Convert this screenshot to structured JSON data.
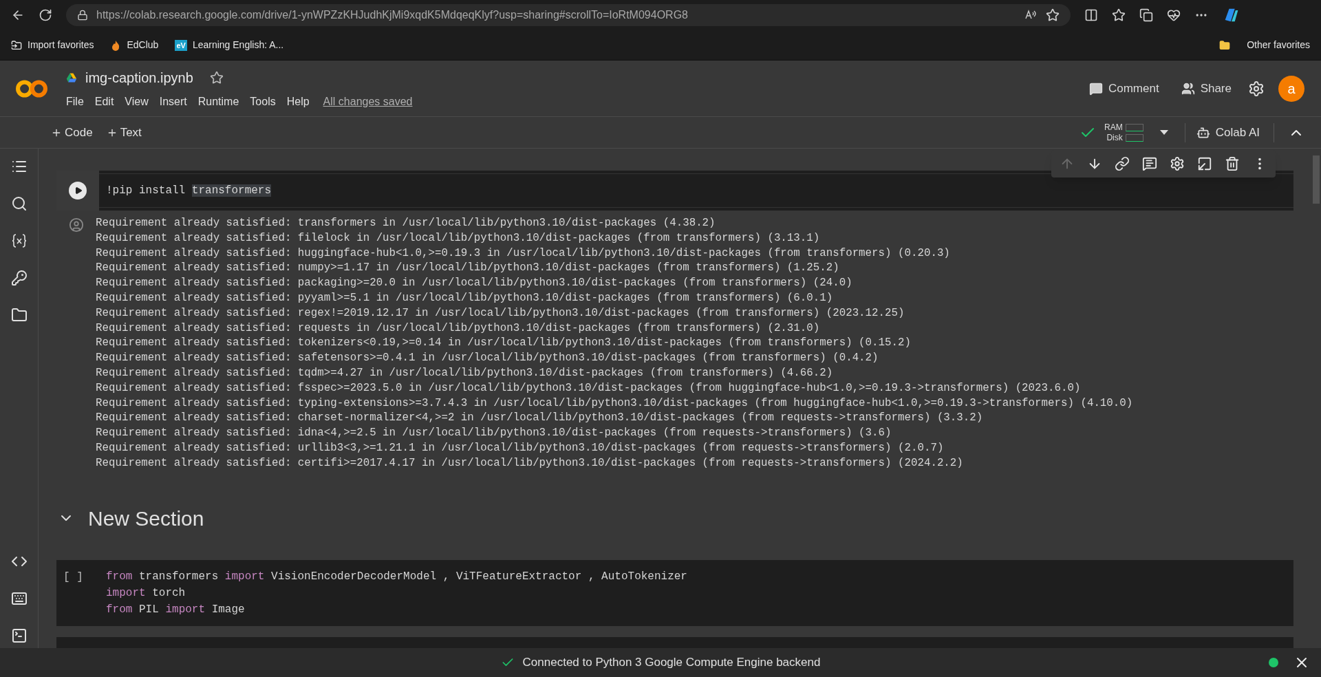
{
  "browser": {
    "url": "https://colab.research.google.com/drive/1-ynWPZzKHJudhKjMi9xqdK5MdqeqKlyf?usp=sharing#scrollTo=IoRtM094ORG8",
    "bookmarks": [
      {
        "kind": "import",
        "label": "Import favorites"
      },
      {
        "kind": "edclub",
        "label": "EdClub"
      },
      {
        "kind": "ev",
        "badge": "eV",
        "label": "Learning English: A..."
      }
    ],
    "other_favorites": "Other favorites"
  },
  "colab": {
    "filename": "img-caption.ipynb",
    "menu": [
      "File",
      "Edit",
      "View",
      "Insert",
      "Runtime",
      "Tools",
      "Help"
    ],
    "save_status": "All changes saved",
    "comment": "Comment",
    "share": "Share",
    "avatar": "a"
  },
  "toolbar": {
    "add": [
      "Code",
      "Text"
    ],
    "ram": "RAM",
    "disk": "Disk",
    "colab_ai": "Colab AI"
  },
  "cell_actions": [
    {
      "kind": "up",
      "disabled": true
    },
    {
      "kind": "down",
      "disabled": false
    },
    {
      "kind": "link",
      "disabled": false
    },
    {
      "kind": "comment",
      "disabled": false
    },
    {
      "kind": "settings",
      "disabled": false
    },
    {
      "kind": "mirror",
      "disabled": false
    },
    {
      "kind": "delete",
      "disabled": false
    },
    {
      "kind": "more",
      "disabled": false
    }
  ],
  "cells": [
    {
      "kind": "code",
      "lines": [
        [
          {
            "kind": "plain",
            "text": "!pip install "
          },
          {
            "kind": "selected",
            "text": "transformers"
          }
        ]
      ],
      "output": [
        "Requirement already satisfied: transformers in /usr/local/lib/python3.10/dist-packages (4.38.2)",
        "Requirement already satisfied: filelock in /usr/local/lib/python3.10/dist-packages (from transformers) (3.13.1)",
        "Requirement already satisfied: huggingface-hub<1.0,>=0.19.3 in /usr/local/lib/python3.10/dist-packages (from transformers) (0.20.3)",
        "Requirement already satisfied: numpy>=1.17 in /usr/local/lib/python3.10/dist-packages (from transformers) (1.25.2)",
        "Requirement already satisfied: packaging>=20.0 in /usr/local/lib/python3.10/dist-packages (from transformers) (24.0)",
        "Requirement already satisfied: pyyaml>=5.1 in /usr/local/lib/python3.10/dist-packages (from transformers) (6.0.1)",
        "Requirement already satisfied: regex!=2019.12.17 in /usr/local/lib/python3.10/dist-packages (from transformers) (2023.12.25)",
        "Requirement already satisfied: requests in /usr/local/lib/python3.10/dist-packages (from transformers) (2.31.0)",
        "Requirement already satisfied: tokenizers<0.19,>=0.14 in /usr/local/lib/python3.10/dist-packages (from transformers) (0.15.2)",
        "Requirement already satisfied: safetensors>=0.4.1 in /usr/local/lib/python3.10/dist-packages (from transformers) (0.4.2)",
        "Requirement already satisfied: tqdm>=4.27 in /usr/local/lib/python3.10/dist-packages (from transformers) (4.66.2)",
        "Requirement already satisfied: fsspec>=2023.5.0 in /usr/local/lib/python3.10/dist-packages (from huggingface-hub<1.0,>=0.19.3->transformers) (2023.6.0)",
        "Requirement already satisfied: typing-extensions>=3.7.4.3 in /usr/local/lib/python3.10/dist-packages (from huggingface-hub<1.0,>=0.19.3->transformers) (4.10.0)",
        "Requirement already satisfied: charset-normalizer<4,>=2 in /usr/local/lib/python3.10/dist-packages (from requests->transformers) (3.3.2)",
        "Requirement already satisfied: idna<4,>=2.5 in /usr/local/lib/python3.10/dist-packages (from requests->transformers) (3.6)",
        "Requirement already satisfied: urllib3<3,>=1.21.1 in /usr/local/lib/python3.10/dist-packages (from requests->transformers) (2.0.7)",
        "Requirement already satisfied: certifi>=2017.4.17 in /usr/local/lib/python3.10/dist-packages (from requests->transformers) (2024.2.2)"
      ]
    },
    {
      "kind": "section",
      "title": "New Section",
      "expanded": true
    },
    {
      "kind": "code",
      "run_label": "[ ]",
      "lines": [
        [
          {
            "kind": "keyword",
            "text": "from"
          },
          {
            "kind": "plain",
            "text": " transformers "
          },
          {
            "kind": "keyword",
            "text": "import"
          },
          {
            "kind": "plain",
            "text": " VisionEncoderDecoderModel , ViTFeatureExtractor , AutoTokenizer"
          }
        ],
        [
          {
            "kind": "keyword",
            "text": "import"
          },
          {
            "kind": "plain",
            "text": " torch"
          }
        ],
        [
          {
            "kind": "keyword",
            "text": "from"
          },
          {
            "kind": "plain",
            "text": " PIL "
          },
          {
            "kind": "keyword",
            "text": "import"
          },
          {
            "kind": "plain",
            "text": " Image"
          }
        ]
      ]
    },
    {
      "kind": "stub"
    }
  ],
  "status": {
    "text": "Connected to Python 3 Google Compute Engine backend",
    "connected": true
  }
}
